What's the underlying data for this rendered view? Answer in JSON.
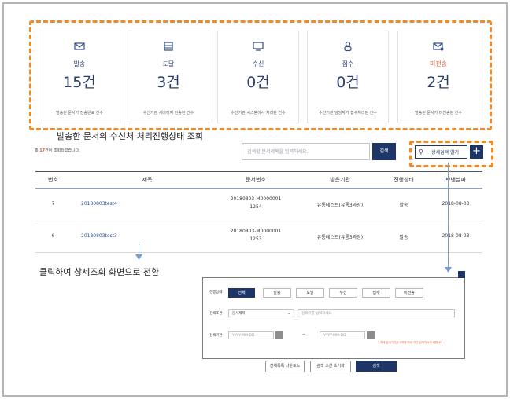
{
  "stats": [
    {
      "label": "발송",
      "value": "15건",
      "desc": "발송된 문서가 전송완료 건수",
      "icon": "mail-icon",
      "color": "#2f4a80"
    },
    {
      "label": "도달",
      "value": "3건",
      "desc": "수신기관 서버까지 전송된 건수",
      "icon": "server-icon",
      "color": "#2f4a80"
    },
    {
      "label": "수신",
      "value": "0건",
      "desc": "수신기관 시스템에서 처리된 건수",
      "icon": "monitor-icon",
      "color": "#2f4a80"
    },
    {
      "label": "접수",
      "value": "0건",
      "desc": "수신기관 담당자가 접수처리된 건수",
      "icon": "person-icon",
      "color": "#2f4a80"
    },
    {
      "label": "미전송",
      "value": "2건",
      "desc": "발송된 문서가 미전송된 건수",
      "icon": "mail-error-icon",
      "color": "#e05b35"
    }
  ],
  "section_title": "발송한 문서의 수신처 처리진행상태 조회",
  "count_prefix": "총 ",
  "count_number": "17",
  "count_suffix": "건이 조회되었습니다.",
  "search": {
    "placeholder": "검색할 문서제목을 입력하세요.",
    "button": "검색",
    "detail_button": "상세검색 열기",
    "plus": "+"
  },
  "table": {
    "headers": [
      "번호",
      "제목",
      "문서번호",
      "받은기관",
      "진행상태",
      "보낸날짜"
    ],
    "rows": [
      {
        "no": "7",
        "title": "20180803test4",
        "doc1": "20180803-M0000001",
        "doc2": "1254",
        "org": "유통테스트(유통3과장)",
        "status": "발송",
        "date": "2018-08-03"
      },
      {
        "no": "6",
        "title": "20180803test3",
        "doc1": "20180803-M0000001",
        "doc2": "1253",
        "org": "유통테스트(유통3과장)",
        "status": "발송",
        "date": "2018-08-03"
      }
    ]
  },
  "click_note": "클릭하여 상세조회 화면으로 전환",
  "panel": {
    "status_label": "진행상태",
    "status_tags": [
      "전체",
      "발송",
      "도달",
      "수신",
      "접수",
      "미전송"
    ],
    "condition_label": "검색조건",
    "condition_select": "문서제목",
    "condition_placeholder": "검색어를 입력하세요",
    "period_label": "검색기간",
    "date_placeholder": "YYYY-MM-DD",
    "range_sep": "~",
    "note": "* 최대 검색기간은 3개월 이내 기간 입력하시기 바랍니다.",
    "btn_download": "전체목록 다운로드",
    "btn_reset": "검색 조건 초기화",
    "btn_search": "검색"
  },
  "colors": {
    "accent": "#1e3667",
    "highlight": "#f08a24",
    "alert": "#e05b35"
  }
}
